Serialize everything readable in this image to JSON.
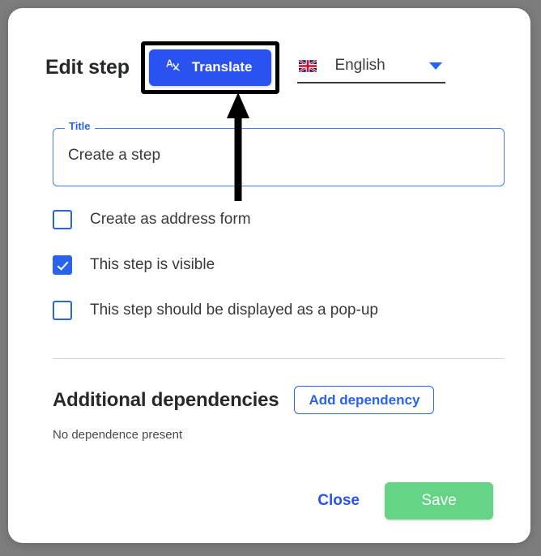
{
  "dialog": {
    "title": "Edit step"
  },
  "header": {
    "translate_button_label": "Translate",
    "translate_icon": "translate-icon",
    "language_flag_icon": "uk-flag-icon",
    "language_value": "English",
    "dropdown_icon": "chevron-down-icon"
  },
  "title_field": {
    "label": "Title",
    "value": "Create a step",
    "placeholder": ""
  },
  "checkboxes": [
    {
      "label": "Create as address form",
      "checked": false
    },
    {
      "label": "This step is visible",
      "checked": true
    },
    {
      "label": "This step should be displayed as a pop-up",
      "checked": false
    }
  ],
  "dependencies": {
    "heading": "Additional dependencies",
    "add_button_label": "Add dependency",
    "empty_text": "No dependence present"
  },
  "footer": {
    "close_label": "Close",
    "save_label": "Save"
  },
  "colors": {
    "accent_blue": "#2a52f0",
    "link_blue": "#2a62f0",
    "save_green": "#66d487",
    "backdrop": "#7d7d7d",
    "text_dark": "#26282b"
  }
}
